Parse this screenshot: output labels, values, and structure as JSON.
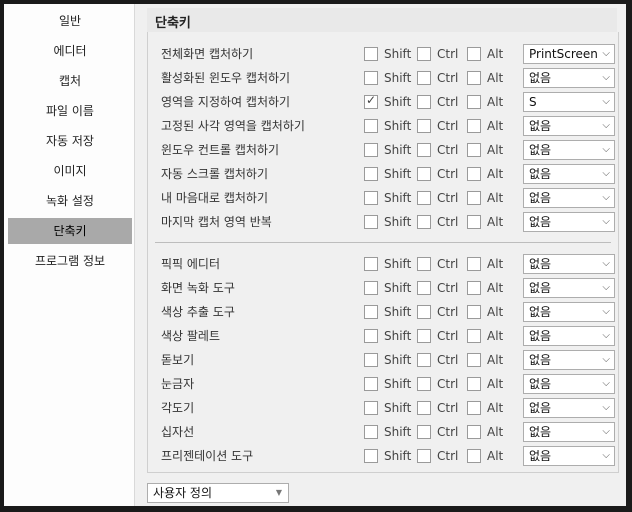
{
  "sidebar": {
    "items": [
      {
        "label": "일반"
      },
      {
        "label": "에디터"
      },
      {
        "label": "캡처"
      },
      {
        "label": "파일 이름"
      },
      {
        "label": "자동 저장"
      },
      {
        "label": "이미지"
      },
      {
        "label": "녹화 설정"
      },
      {
        "label": "단축키"
      },
      {
        "label": "프로그램 정보"
      }
    ],
    "active_index": 7
  },
  "section": {
    "title": "단축키"
  },
  "modifiers": {
    "shift": "Shift",
    "ctrl": "Ctrl",
    "alt": "Alt"
  },
  "shortcuts": [
    {
      "label": "전체화면 캡처하기",
      "shift": false,
      "ctrl": false,
      "alt": false,
      "key": "PrintScreen"
    },
    {
      "label": "활성화된 윈도우 캡처하기",
      "shift": false,
      "ctrl": false,
      "alt": false,
      "key": "없음"
    },
    {
      "label": "영역을 지정하여 캡처하기",
      "shift": true,
      "ctrl": false,
      "alt": false,
      "key": "S"
    },
    {
      "label": "고정된 사각 영역을 캡처하기",
      "shift": false,
      "ctrl": false,
      "alt": false,
      "key": "없음"
    },
    {
      "label": "윈도우 컨트롤 캡처하기",
      "shift": false,
      "ctrl": false,
      "alt": false,
      "key": "없음"
    },
    {
      "label": "자동 스크롤 캡처하기",
      "shift": false,
      "ctrl": false,
      "alt": false,
      "key": "없음"
    },
    {
      "label": "내 마음대로 캡처하기",
      "shift": false,
      "ctrl": false,
      "alt": false,
      "key": "없음"
    },
    {
      "label": "마지막 캡처 영역 반복",
      "shift": false,
      "ctrl": false,
      "alt": false,
      "key": "없음"
    }
  ],
  "tools": [
    {
      "label": "픽픽 에디터",
      "shift": false,
      "ctrl": false,
      "alt": false,
      "key": "없음"
    },
    {
      "label": "화면 녹화 도구",
      "shift": false,
      "ctrl": false,
      "alt": false,
      "key": "없음"
    },
    {
      "label": "색상 추출 도구",
      "shift": false,
      "ctrl": false,
      "alt": false,
      "key": "없음"
    },
    {
      "label": "색상 팔레트",
      "shift": false,
      "ctrl": false,
      "alt": false,
      "key": "없음"
    },
    {
      "label": "돋보기",
      "shift": false,
      "ctrl": false,
      "alt": false,
      "key": "없음"
    },
    {
      "label": "눈금자",
      "shift": false,
      "ctrl": false,
      "alt": false,
      "key": "없음"
    },
    {
      "label": "각도기",
      "shift": false,
      "ctrl": false,
      "alt": false,
      "key": "없음"
    },
    {
      "label": "십자선",
      "shift": false,
      "ctrl": false,
      "alt": false,
      "key": "없음"
    },
    {
      "label": "프리젠테이션 도구",
      "shift": false,
      "ctrl": false,
      "alt": false,
      "key": "없음"
    }
  ],
  "profile": {
    "value": "사용자 정의"
  }
}
